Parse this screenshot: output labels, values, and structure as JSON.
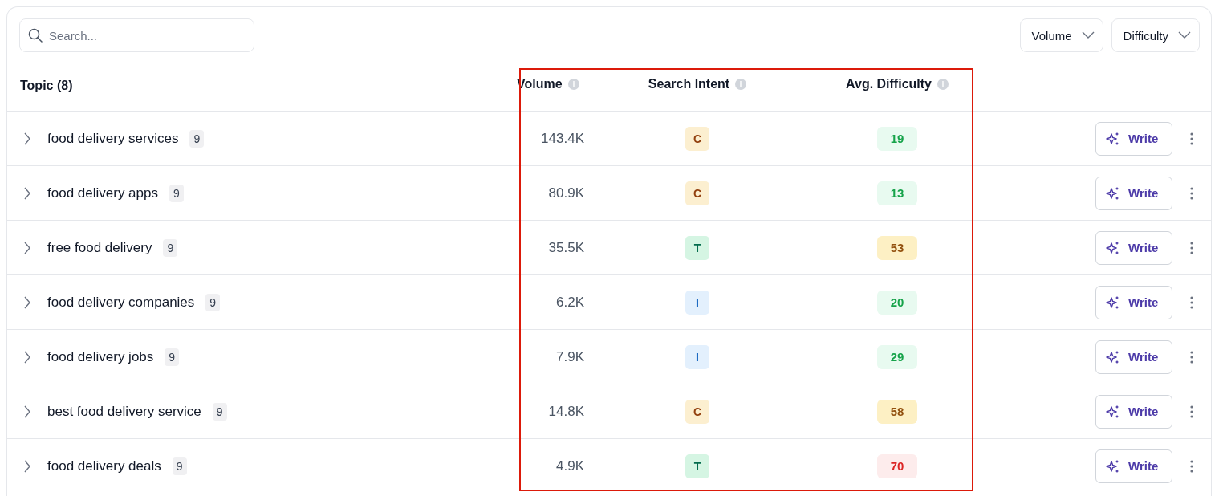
{
  "search": {
    "placeholder": "Search..."
  },
  "filters": [
    {
      "label": "Volume"
    },
    {
      "label": "Difficulty"
    }
  ],
  "table": {
    "columns": [
      {
        "label": "Topic (8)",
        "info": false
      },
      {
        "label": "Volume",
        "info": true
      },
      {
        "label": "Search Intent",
        "info": true
      },
      {
        "label": "Avg. Difficulty",
        "info": true
      }
    ],
    "highlighted_columns": true,
    "rows": [
      {
        "topic": "food delivery services",
        "count": "9",
        "volume": "143.4K",
        "intent": {
          "label": "C",
          "kind": "commercial"
        },
        "difficulty": {
          "label": "19",
          "kind": "easy"
        },
        "action": "Write"
      },
      {
        "topic": "food delivery apps",
        "count": "9",
        "volume": "80.9K",
        "intent": {
          "label": "C",
          "kind": "commercial"
        },
        "difficulty": {
          "label": "13",
          "kind": "easy"
        },
        "action": "Write"
      },
      {
        "topic": "free food delivery",
        "count": "9",
        "volume": "35.5K",
        "intent": {
          "label": "T",
          "kind": "transactional"
        },
        "difficulty": {
          "label": "53",
          "kind": "medium"
        },
        "action": "Write"
      },
      {
        "topic": "food delivery companies",
        "count": "9",
        "volume": "6.2K",
        "intent": {
          "label": "I",
          "kind": "informational"
        },
        "difficulty": {
          "label": "20",
          "kind": "easy"
        },
        "action": "Write"
      },
      {
        "topic": "food delivery jobs",
        "count": "9",
        "volume": "7.9K",
        "intent": {
          "label": "I",
          "kind": "informational"
        },
        "difficulty": {
          "label": "29",
          "kind": "easy"
        },
        "action": "Write"
      },
      {
        "topic": "best food delivery service",
        "count": "9",
        "volume": "14.8K",
        "intent": {
          "label": "C",
          "kind": "commercial"
        },
        "difficulty": {
          "label": "58",
          "kind": "medium"
        },
        "action": "Write"
      },
      {
        "topic": "food delivery deals",
        "count": "9",
        "volume": "4.9K",
        "intent": {
          "label": "T",
          "kind": "transactional"
        },
        "difficulty": {
          "label": "70",
          "kind": "hard"
        },
        "action": "Write"
      }
    ]
  }
}
